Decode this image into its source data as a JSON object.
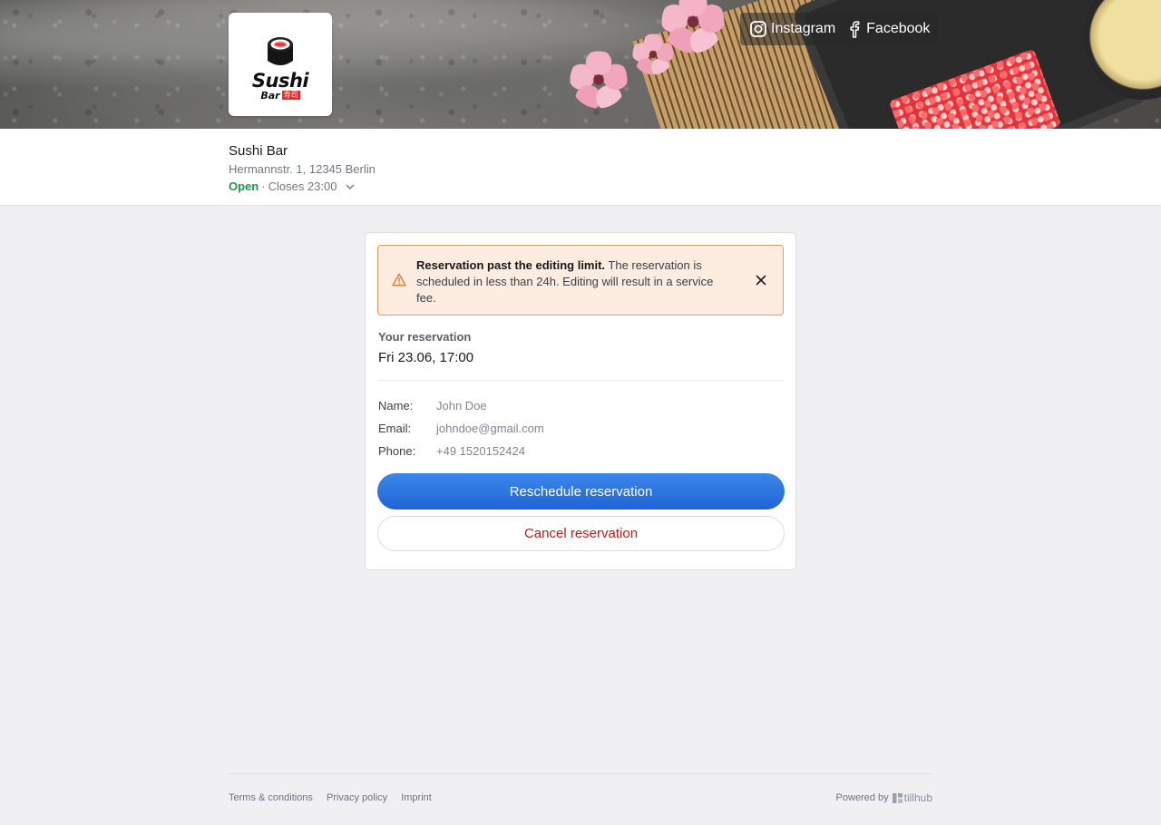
{
  "header": {
    "logo": {
      "word": "Sushi",
      "sub": "Bar",
      "kanji": "寿司"
    },
    "social": [
      {
        "label": "Instagram",
        "icon": "instagram-icon"
      },
      {
        "label": "Facebook",
        "icon": "facebook-icon"
      }
    ]
  },
  "venue": {
    "name": "Sushi Bar",
    "address": "Hermannstr. 1, 12345 Berlin",
    "status": "Open",
    "separator": "·",
    "closing": "Closes 23:00",
    "status_color": "#1c9a4a"
  },
  "alert": {
    "title": "Reservation past the editing limit.",
    "message": " The reservation is scheduled in less than 24h. Editing will result in a service fee.",
    "icon": "warning-icon",
    "accent": "#e9995f"
  },
  "reservation": {
    "label": "Your reservation",
    "datetime": "Fri 23.06, 17:00",
    "details": [
      {
        "key": "Name:",
        "value": "John Doe"
      },
      {
        "key": "Email:",
        "value": "johndoe@gmail.com"
      },
      {
        "key": "Phone:",
        "value": "+49 1520152424"
      }
    ],
    "reschedule_label": "Reschedule reservation",
    "cancel_label": "Cancel reservation",
    "primary_color": "#2a72dd",
    "danger_color": "#c01a1a"
  },
  "footer": {
    "links": [
      "Terms & conditions",
      "Privacy policy",
      "Imprint"
    ],
    "powered_by": "Powered by",
    "brand": "tillhub"
  }
}
